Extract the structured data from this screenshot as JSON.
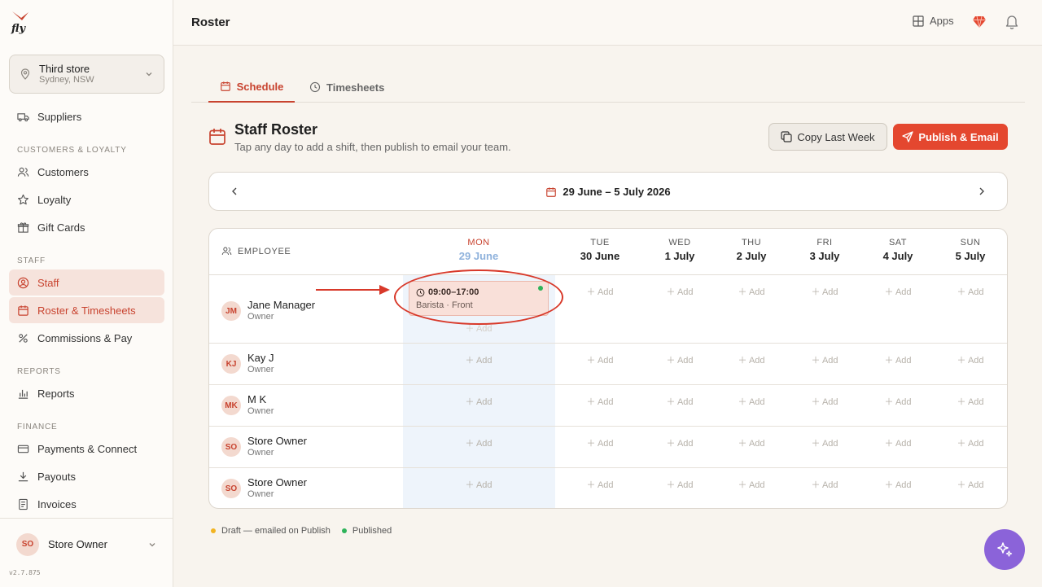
{
  "app": {
    "logo_text": "fly",
    "version": "v2.7.875"
  },
  "store": {
    "name": "Third store",
    "location": "Sydney, NSW"
  },
  "sidebar": {
    "top_items": [
      {
        "label": "Suppliers"
      }
    ],
    "sections": [
      {
        "label": "CUSTOMERS & LOYALTY",
        "items": [
          {
            "label": "Customers"
          },
          {
            "label": "Loyalty"
          },
          {
            "label": "Gift Cards"
          }
        ]
      },
      {
        "label": "STAFF",
        "items": [
          {
            "label": "Staff"
          },
          {
            "label": "Roster & Timesheets"
          },
          {
            "label": "Commissions & Pay"
          }
        ]
      },
      {
        "label": "REPORTS",
        "items": [
          {
            "label": "Reports"
          }
        ]
      },
      {
        "label": "FINANCE",
        "items": [
          {
            "label": "Payments & Connect"
          },
          {
            "label": "Payouts"
          },
          {
            "label": "Invoices"
          }
        ]
      }
    ],
    "user": {
      "initials": "SO",
      "name": "Store Owner"
    }
  },
  "topbar": {
    "title": "Roster",
    "apps_label": "Apps"
  },
  "tabs": [
    {
      "label": "Schedule"
    },
    {
      "label": "Timesheets"
    }
  ],
  "header": {
    "title": "Staff Roster",
    "subtitle": "Tap any day to add a shift, then publish to email your team.",
    "copy_label": "Copy Last Week",
    "publish_label": "Publish & Email"
  },
  "week": {
    "label": "29 June – 5 July 2026"
  },
  "grid": {
    "employee_header": "EMPLOYEE",
    "add_label": "Add",
    "days": [
      {
        "name": "MON",
        "date": "29 June"
      },
      {
        "name": "TUE",
        "date": "30 June"
      },
      {
        "name": "WED",
        "date": "1 July"
      },
      {
        "name": "THU",
        "date": "2 July"
      },
      {
        "name": "FRI",
        "date": "3 July"
      },
      {
        "name": "SAT",
        "date": "4 July"
      },
      {
        "name": "SUN",
        "date": "5 July"
      }
    ],
    "employees": [
      {
        "initials": "JM",
        "name": "Jane Manager",
        "role": "Owner"
      },
      {
        "initials": "KJ",
        "name": "Kay J",
        "role": "Owner"
      },
      {
        "initials": "MK",
        "name": "M K",
        "role": "Owner"
      },
      {
        "initials": "SO",
        "name": "Store Owner",
        "role": "Owner"
      },
      {
        "initials": "SO",
        "name": "Store Owner",
        "role": "Owner"
      }
    ],
    "shift": {
      "time": "09:00–17:00",
      "role": "Barista · Front",
      "status_color": "#2eb35a"
    }
  },
  "legend": [
    {
      "label": "Draft — emailed on Publish",
      "color": "#f2b422"
    },
    {
      "label": "Published",
      "color": "#2eb35a"
    }
  ],
  "colors": {
    "accent": "#e4472f",
    "assistant": "#8b63d9",
    "annotation": "#d8392a"
  }
}
